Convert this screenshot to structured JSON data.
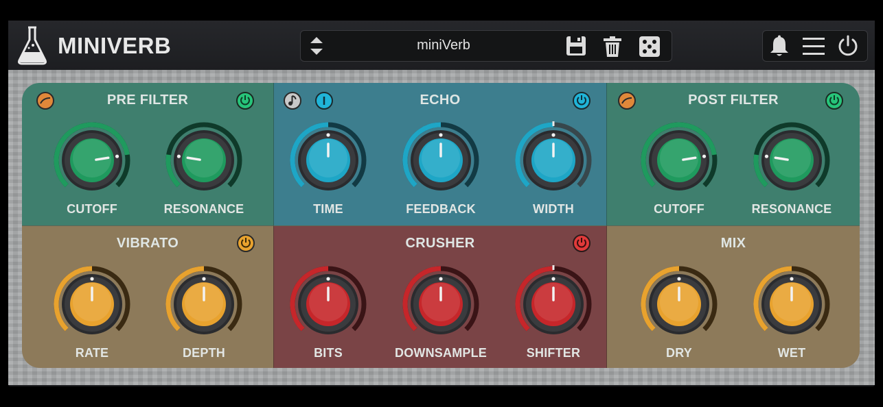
{
  "app": {
    "title": "MINIVERB"
  },
  "header": {
    "preset_name": "miniVerb",
    "icons": [
      "flask-icon",
      "up-down-arrows-icon",
      "save-icon",
      "trash-icon",
      "dice-icon",
      "bell-icon",
      "menu-icon",
      "power-icon"
    ]
  },
  "colors": {
    "filter": "#3f7f6e",
    "echo": "#3d7e8e",
    "vibrato": "#8d7a5a",
    "crusher": "#7a4446",
    "mix": "#8d7a5a",
    "green_knob": "#1f9a5e",
    "teal_knob": "#1ea6c6",
    "orange_knob": "#e8a22e",
    "red_knob": "#c6262a"
  },
  "sections": {
    "pre_filter": {
      "title": "PRE FILTER",
      "knobs": [
        {
          "label": "CUTOFF",
          "value": 0.8
        },
        {
          "label": "RESONANCE",
          "value": 0.2
        }
      ]
    },
    "echo": {
      "title": "ECHO",
      "knobs": [
        {
          "label": "TIME",
          "value": 0.5
        },
        {
          "label": "FEEDBACK",
          "value": 0.5
        },
        {
          "label": "WIDTH",
          "value": 0.5
        }
      ]
    },
    "post_filter": {
      "title": "POST FILTER",
      "knobs": [
        {
          "label": "CUTOFF",
          "value": 0.8
        },
        {
          "label": "RESONANCE",
          "value": 0.2
        }
      ]
    },
    "vibrato": {
      "title": "VIBRATO",
      "knobs": [
        {
          "label": "RATE",
          "value": 0.5
        },
        {
          "label": "DEPTH",
          "value": 0.5
        }
      ]
    },
    "crusher": {
      "title": "CRUSHER",
      "knobs": [
        {
          "label": "BITS",
          "value": 0.5
        },
        {
          "label": "DOWNSAMPLE",
          "value": 0.5
        },
        {
          "label": "SHIFTER",
          "value": 0.5
        }
      ]
    },
    "mix": {
      "title": "MIX",
      "knobs": [
        {
          "label": "DRY",
          "value": 0.5
        },
        {
          "label": "WET",
          "value": 0.5
        }
      ]
    }
  }
}
